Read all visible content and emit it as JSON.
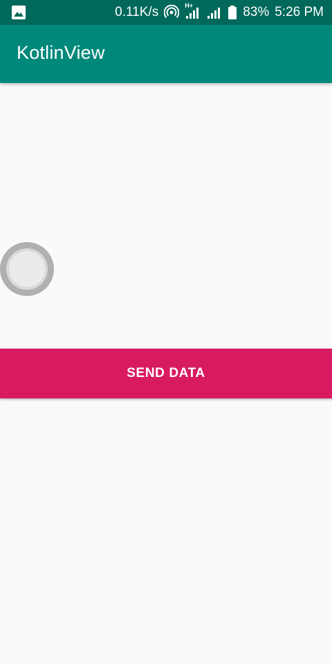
{
  "status_bar": {
    "network_speed": "0.11K/s",
    "network_type": "H+",
    "battery_percent": "83%",
    "time": "5:26 PM",
    "icons": [
      "image-notification-icon",
      "hotspot-icon",
      "signal-icon",
      "signal-icon",
      "battery-icon"
    ]
  },
  "app_bar": {
    "title": "KotlinView"
  },
  "main": {
    "send_button_label": "SEND DATA"
  },
  "colors": {
    "status_bar": "#00695c",
    "app_bar": "#00897b",
    "accent": "#d81b60",
    "background": "#fafafa"
  }
}
